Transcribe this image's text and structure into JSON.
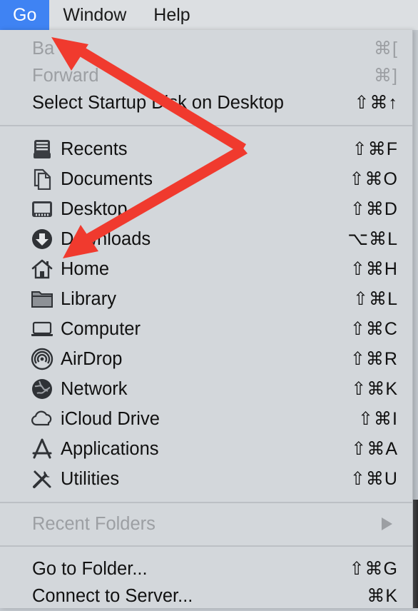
{
  "menubar": {
    "items": [
      {
        "label": "Go",
        "active": true
      },
      {
        "label": "Window",
        "active": false
      },
      {
        "label": "Help",
        "active": false
      }
    ]
  },
  "menu": {
    "nav": [
      {
        "label": "Back",
        "visible_text": "Ba",
        "shortcut": "⌘[",
        "disabled": true
      },
      {
        "label": "Forward",
        "shortcut": "⌘]",
        "disabled": true
      },
      {
        "label": "Select Startup Disk on Desktop",
        "shortcut": "⇧⌘↑",
        "disabled": false
      }
    ],
    "places": [
      {
        "label": "Recents",
        "shortcut": "⇧⌘F",
        "icon": "recents-icon"
      },
      {
        "label": "Documents",
        "shortcut": "⇧⌘O",
        "icon": "documents-icon"
      },
      {
        "label": "Desktop",
        "shortcut": "⇧⌘D",
        "icon": "desktop-icon"
      },
      {
        "label": "Downloads",
        "shortcut": "⌥⌘L",
        "icon": "downloads-icon"
      },
      {
        "label": "Home",
        "shortcut": "⇧⌘H",
        "icon": "home-icon"
      },
      {
        "label": "Library",
        "shortcut": "⇧⌘L",
        "icon": "folder-icon"
      },
      {
        "label": "Computer",
        "shortcut": "⇧⌘C",
        "icon": "laptop-icon"
      },
      {
        "label": "AirDrop",
        "shortcut": "⇧⌘R",
        "icon": "airdrop-icon"
      },
      {
        "label": "Network",
        "shortcut": "⇧⌘K",
        "icon": "network-globe-icon"
      },
      {
        "label": "iCloud Drive",
        "shortcut": "⇧⌘I",
        "icon": "cloud-icon"
      },
      {
        "label": "Applications",
        "shortcut": "⇧⌘A",
        "icon": "applications-icon"
      },
      {
        "label": "Utilities",
        "shortcut": "⇧⌘U",
        "icon": "utilities-tools-icon"
      }
    ],
    "recent_folders": {
      "label": "Recent Folders",
      "disabled": true
    },
    "actions": [
      {
        "label": "Go to Folder...",
        "shortcut": "⇧⌘G"
      },
      {
        "label": "Connect to Server...",
        "shortcut": "⌘K"
      }
    ]
  },
  "annotation_color": "#f03a2e"
}
